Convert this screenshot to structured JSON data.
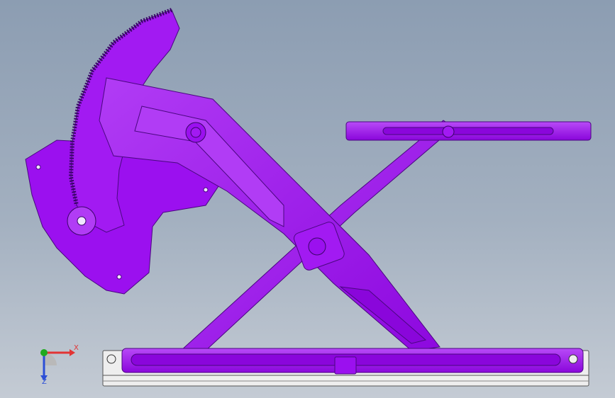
{
  "app": {
    "title": ""
  },
  "viewport": {
    "background_top": "#8c9db2",
    "background_bottom": "#c4cbd4",
    "model_color": "#9b10ef",
    "model_shade": "#7a0bc0",
    "model_highlight": "#c85bff"
  },
  "triad": {
    "x_label": "X",
    "z_label": "Z",
    "x_color": "#e23434",
    "y_color": "#1faa1f",
    "z_color": "#2c4fd6"
  }
}
